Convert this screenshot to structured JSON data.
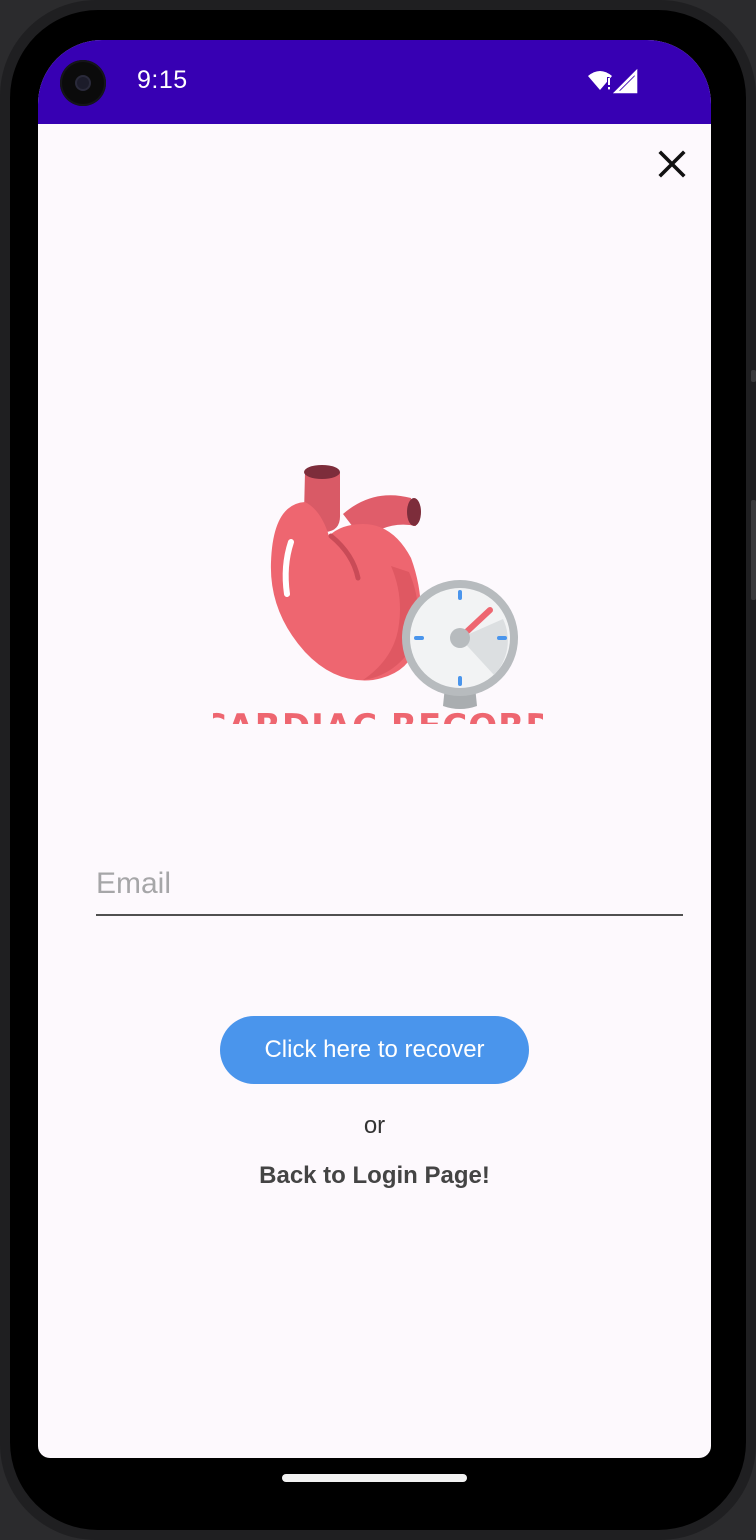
{
  "status_bar": {
    "time": "9:15",
    "background_color": "#3700b3",
    "icons": [
      "wifi-icon",
      "signal-icon"
    ]
  },
  "toolbar": {
    "close_icon": "close-icon"
  },
  "logo": {
    "text": "CARDIAC RECORD",
    "color": "#ee6670"
  },
  "form": {
    "email_placeholder": "Email",
    "email_value": ""
  },
  "actions": {
    "recover_label": "Click here to recover",
    "recover_color": "#4a95ec",
    "or_label": "or",
    "back_label": "Back to Login Page!"
  }
}
